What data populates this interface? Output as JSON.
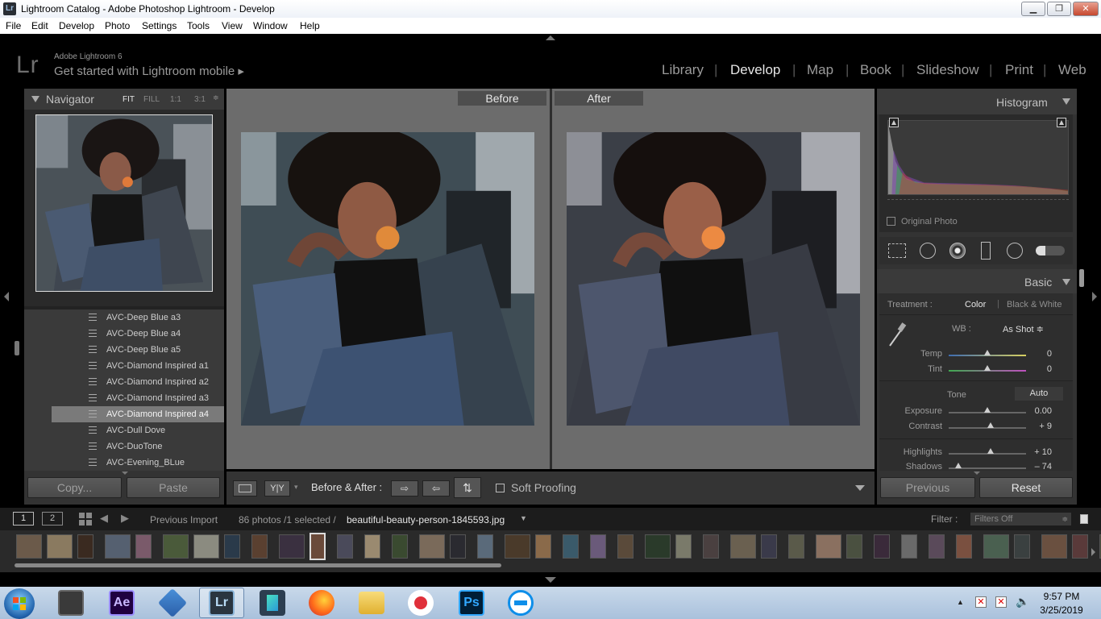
{
  "window": {
    "title": "Lightroom Catalog - Adobe Photoshop Lightroom - Develop",
    "app_icon": "Lr"
  },
  "menu": [
    "File",
    "Edit",
    "Develop",
    "Photo",
    "Settings",
    "Tools",
    "View",
    "Window",
    "Help"
  ],
  "identity": {
    "logo": "Lr",
    "version": "Adobe Lightroom 6",
    "mobile": "Get started with Lightroom mobile ▸"
  },
  "modules": [
    "Library",
    "Develop",
    "Map",
    "Book",
    "Slideshow",
    "Print",
    "Web"
  ],
  "active_module": "Develop",
  "navigator": {
    "title": "Navigator",
    "zoom": [
      "FIT",
      "FILL",
      "1:1",
      "3:1"
    ],
    "zoom_active": "FIT"
  },
  "presets": [
    "AVC-Deep Blue a3",
    "AVC-Deep Blue a4",
    "AVC-Deep Blue a5",
    "AVC-Diamond Inspired a1",
    "AVC-Diamond Inspired a2",
    "AVC-Diamond Inspired a3",
    "AVC-Diamond Inspired a4",
    "AVC-Dull Dove",
    "AVC-DuoTone",
    "AVC-Evening_BLue"
  ],
  "selected_preset": "AVC-Diamond Inspired a4",
  "left_buttons": {
    "copy": "Copy...",
    "paste": "Paste"
  },
  "compare": {
    "before": "Before",
    "after": "After"
  },
  "toolbar": {
    "yy": "Y|Y",
    "before_after": "Before & After :",
    "soft_proofing": "Soft Proofing"
  },
  "histogram": {
    "title": "Histogram",
    "original_photo": "Original Photo"
  },
  "basic": {
    "title": "Basic",
    "treatment_label": "Treatment :",
    "treatment_color": "Color",
    "treatment_bw": "Black & White",
    "wb_label": "WB :",
    "wb_value": "As Shot ≑",
    "temp": {
      "label": "Temp",
      "value": "0",
      "pos": 0.5
    },
    "tint": {
      "label": "Tint",
      "value": "0",
      "pos": 0.5
    },
    "tone_label": "Tone",
    "auto": "Auto",
    "exposure": {
      "label": "Exposure",
      "value": "0.00",
      "pos": 0.5
    },
    "contrast": {
      "label": "Contrast",
      "value": "+ 9",
      "pos": 0.55
    },
    "highlights": {
      "label": "Highlights",
      "value": "+ 10",
      "pos": 0.55
    },
    "shadows": {
      "label": "Shadows",
      "value": "– 74",
      "pos": 0.13
    }
  },
  "right_buttons": {
    "previous": "Previous",
    "reset": "Reset"
  },
  "filmstrip_bar": {
    "screen1": "1",
    "screen2": "2",
    "source": "Previous Import",
    "count": "86 photos /1 selected /",
    "filename": "beautiful-beauty-person-1845593.jpg",
    "filter_label": "Filter :",
    "filter_value": "Filters Off"
  },
  "taskbar": {
    "time": "9:57 PM",
    "date": "3/25/2019",
    "apps": [
      "media-player",
      "after-effects",
      "diamond-app",
      "lightroom",
      "filmora",
      "firefox",
      "file-explorer",
      "screen-recorder",
      "photoshop",
      "teamviewer"
    ],
    "ae": "Ae",
    "lr": "Lr",
    "ps": "Ps"
  },
  "colors": {
    "panel": "#333333",
    "accent": "#e6e6e6",
    "bg": "#000000"
  }
}
